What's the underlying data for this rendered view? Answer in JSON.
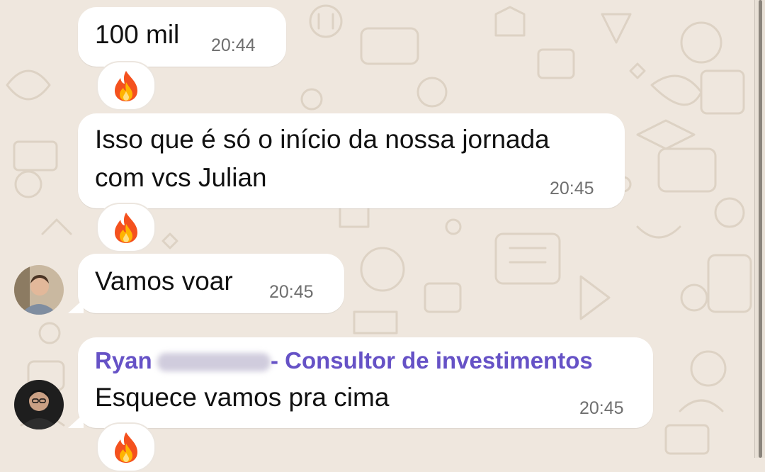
{
  "colors": {
    "chat_background": "#efe7de",
    "bubble": "#ffffff",
    "sender_name": "#6652c6",
    "timestamp": "#6f6f6f"
  },
  "messages": [
    {
      "text": "100 mil",
      "time": "20:44",
      "reaction": "fire-emoji"
    },
    {
      "text_line1": "Isso que é só o início da nossa jornada",
      "text_line2": "com vcs Julian",
      "time": "20:45",
      "reaction": "fire-emoji"
    },
    {
      "text": "Vamos voar",
      "time": "20:45"
    },
    {
      "sender_first": "Ryan",
      "sender_suffix": " - Consultor de investimentos",
      "text": "Esquece vamos pra cima",
      "time": "20:45",
      "reaction": "fire-emoji"
    }
  ]
}
